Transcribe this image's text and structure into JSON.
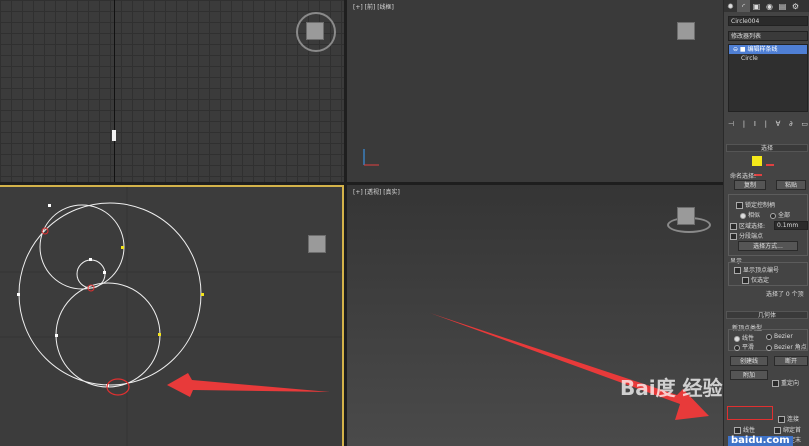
{
  "viewports": {
    "top": {
      "label": ""
    },
    "front": {
      "label": "[+] [前] [线框]"
    },
    "left": {
      "label": ""
    },
    "perspective": {
      "label": "[+] [透视] [真实]"
    }
  },
  "command_panel": {
    "tabs": [
      "✹",
      "◜",
      "▣",
      "◉",
      "▤",
      "⚙"
    ],
    "active_tab": 1,
    "object_name": "Circle004",
    "modifier_list_label": "修改器列表",
    "stack": [
      {
        "label": "⊖ ■ 编辑样条线",
        "selected": true
      },
      {
        "label": "Circle",
        "selected": false
      }
    ],
    "toolbar_glyphs": [
      "⊣",
      "|",
      "Ⅰ",
      "|",
      "∀",
      "∂",
      "▭"
    ],
    "selection": {
      "header": "选择",
      "named_selection": "命名选择:",
      "copy": "复制",
      "paste": "粘贴",
      "lock_handles": "锁定控制柄",
      "similar": "相似",
      "all": "全部",
      "area_selection": "区域选择:",
      "area_value": "0.1mm",
      "segment_end": "分段端点",
      "select_by": "选择方式...",
      "display": "显示",
      "show_vertex_numbers": "显示顶点编号",
      "only_selected": "仅选定",
      "status": "选择了 0 个顶"
    },
    "geometry": {
      "header": "几何体",
      "new_vertex_type": "新顶点类型",
      "linear": "线性",
      "bezier": "Bezier",
      "smooth": "平滑",
      "bezier_corner": "Bezier 角点",
      "create_line": "创建线",
      "break": "断开",
      "attach": "附加",
      "reorient": "重定向",
      "connect": "连接",
      "linear2": "线性",
      "bind_first": "绑定首",
      "closed": "闭合",
      "bind_last": "绑定末"
    }
  },
  "watermark": {
    "text": "Bai度 经验",
    "sub": "baidu.com"
  },
  "colors": {
    "accent_yellow": "#d4b34a",
    "red_annotation": "#e03030",
    "selection_blue": "#4f7fd4"
  }
}
